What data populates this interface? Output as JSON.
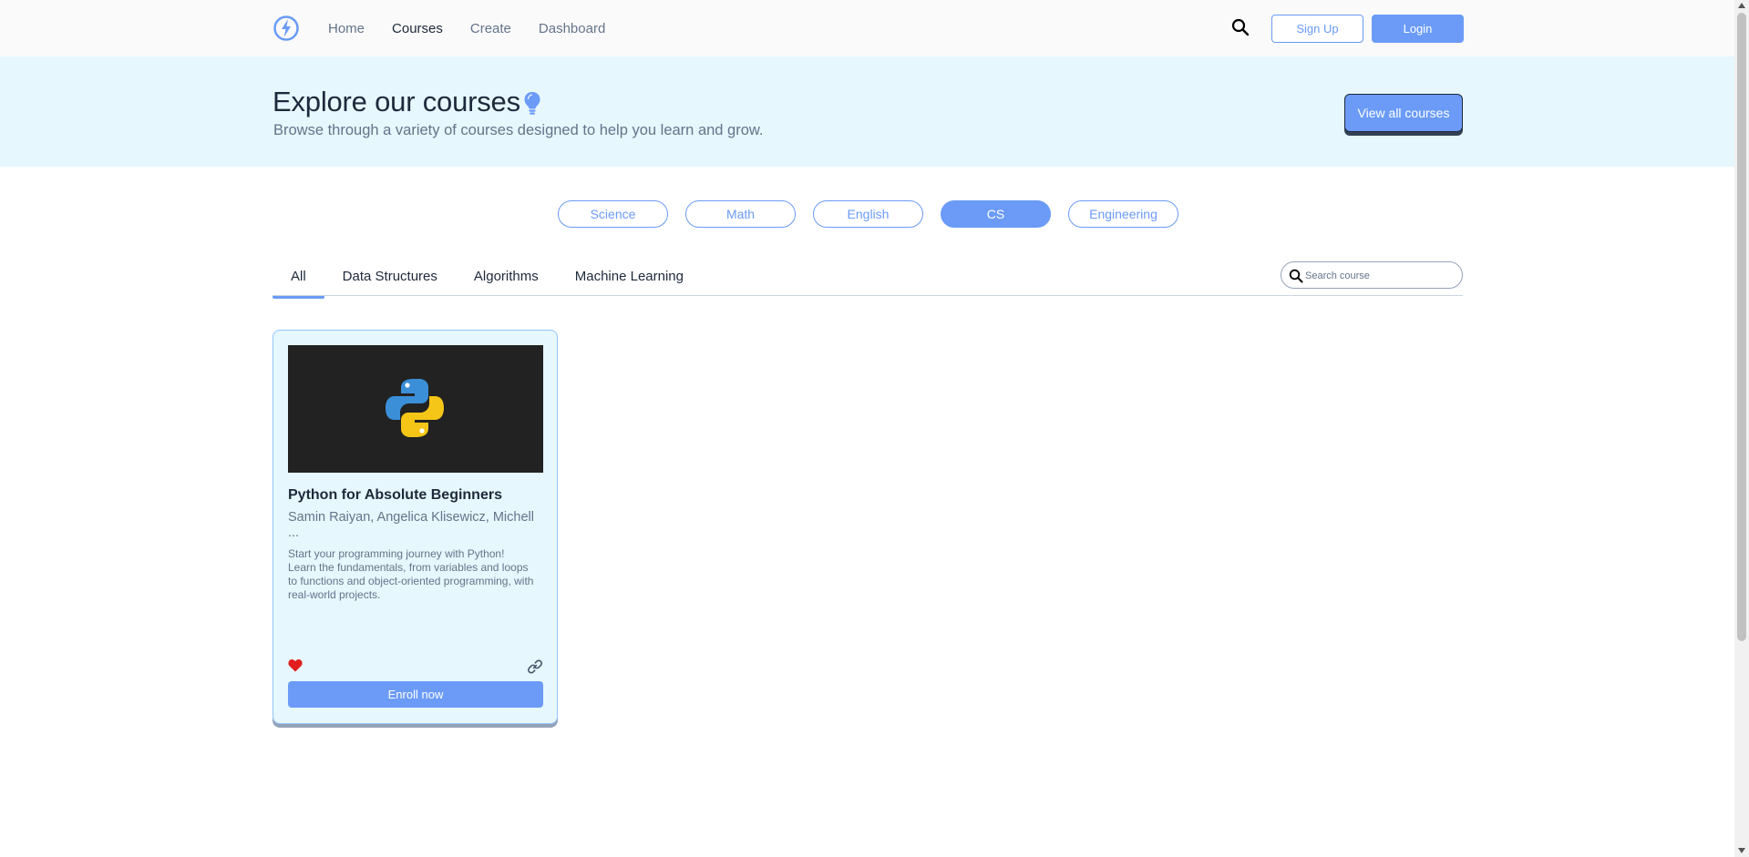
{
  "nav": {
    "logo_icon": "bolt-logo-icon",
    "links": [
      {
        "label": "Home",
        "active": false
      },
      {
        "label": "Courses",
        "active": true
      },
      {
        "label": "Create",
        "active": false
      },
      {
        "label": "Dashboard",
        "active": false
      }
    ],
    "search_icon": "search-icon",
    "signup_label": "Sign Up",
    "login_label": "Login"
  },
  "hero": {
    "title": "Explore our courses",
    "title_icon": "lightbulb-icon",
    "subtitle": "Browse through a variety of courses designed to help you learn and grow.",
    "view_all_label": "View all courses"
  },
  "subjects": {
    "items": [
      "Science",
      "Math",
      "English",
      "CS",
      "Engineering"
    ],
    "selected": "CS"
  },
  "tabs": {
    "items": [
      "All",
      "Data Structures",
      "Algorithms",
      "Machine Learning"
    ],
    "active": "All"
  },
  "search": {
    "placeholder": "Search course",
    "value": ""
  },
  "courses": [
    {
      "title": "Python for Absolute Beginners",
      "authors": "Samin Raiyan, Angelica Klisewicz, Michell ...",
      "description": "Start your programming journey with Python! Learn the fundamentals, from variables and loops to functions and object-oriented programming, with real-world projects.",
      "thumbnail_icon": "python-logo-icon",
      "favorite_icon": "heart-icon",
      "share_icon": "link-icon",
      "enroll_label": "Enroll now"
    }
  ],
  "colors": {
    "accent": "#6b9bf7",
    "hero_bg": "#e6f7fd",
    "text_dark": "#1e293b",
    "text_muted": "#64748b",
    "favorite": "#e11d1d"
  }
}
